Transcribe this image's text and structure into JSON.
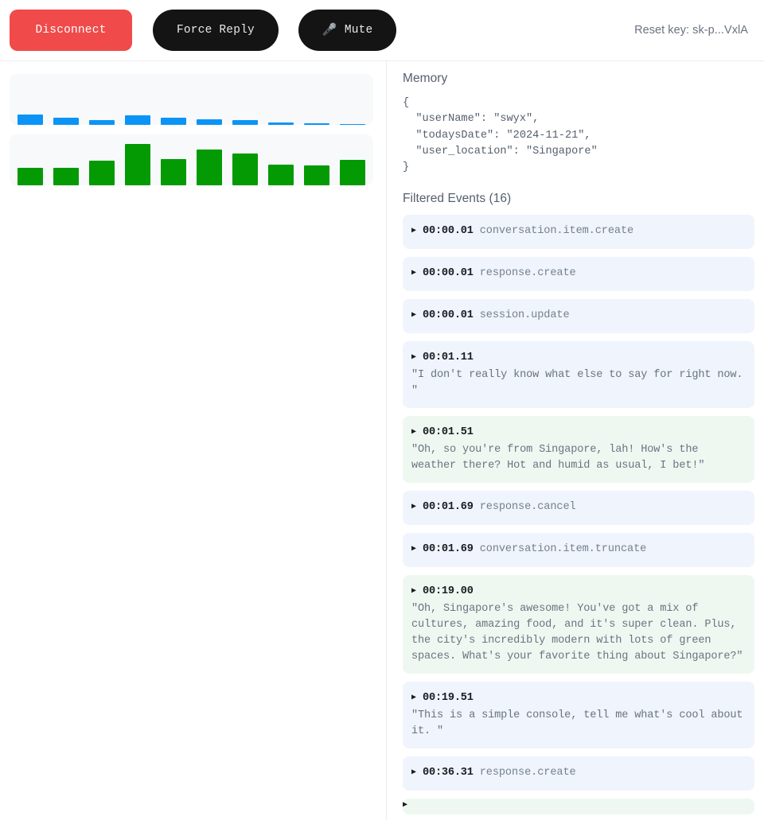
{
  "header": {
    "disconnect_label": "Disconnect",
    "force_reply_label": "Force Reply",
    "mute_label": "Mute",
    "mute_icon": "mute-microphone-icon",
    "mute_glyph": "🎤",
    "reset_key_text": "Reset key: sk-p...VxlA",
    "disconnect_color": "#f04a4a",
    "dark_button_color": "#141414"
  },
  "visualizer": {
    "client": {
      "name": "client-audio-visualizer",
      "color": "#0b94f5",
      "bars": [
        13,
        9,
        6,
        12,
        9,
        7,
        6,
        3,
        2,
        1
      ]
    },
    "server": {
      "name": "server-audio-visualizer",
      "color": "#049a04",
      "bars": [
        22,
        22,
        31,
        52,
        33,
        45,
        40,
        26,
        25,
        32
      ]
    }
  },
  "memory": {
    "title": "Memory",
    "json": "{\n  \"userName\": \"swyx\",\n  \"todaysDate\": \"2024-11-21\",\n  \"user_location\": \"Singapore\"\n}"
  },
  "events": {
    "title": "Filtered Events (16)",
    "count": 16,
    "items": [
      {
        "time": "00:00.01",
        "type": "conversation.item.create",
        "body": "",
        "side": "client"
      },
      {
        "time": "00:00.01",
        "type": "response.create",
        "body": "",
        "side": "client"
      },
      {
        "time": "00:00.01",
        "type": "session.update",
        "body": "",
        "side": "client"
      },
      {
        "time": "00:01.11",
        "type": "",
        "body": "\"I don't really know what else to say for right now. \"",
        "side": "client"
      },
      {
        "time": "00:01.51",
        "type": "",
        "body": "\"Oh, so you're from Singapore, lah! How's the weather there? Hot and humid as usual, I bet!\"",
        "side": "server"
      },
      {
        "time": "00:01.69",
        "type": "response.cancel",
        "body": "",
        "side": "client"
      },
      {
        "time": "00:01.69",
        "type": "conversation.item.truncate",
        "body": "",
        "side": "client"
      },
      {
        "time": "00:19.00",
        "type": "",
        "body": "\"Oh, Singapore's awesome! You've got a mix of cultures, amazing food, and it's super clean. Plus, the city's incredibly modern with lots of green spaces. What's your favorite thing about Singapore?\"",
        "side": "server"
      },
      {
        "time": "00:19.51",
        "type": "",
        "body": "\"This is a simple console, tell me what's cool about it. \"",
        "side": "client"
      },
      {
        "time": "00:36.31",
        "type": "response.create",
        "body": "",
        "side": "client"
      },
      {
        "time": "",
        "type": "",
        "body": "",
        "side": "server"
      }
    ],
    "caret_glyph": "▶",
    "client_bg": "#eff4fd",
    "server_bg": "#eef8f1"
  }
}
